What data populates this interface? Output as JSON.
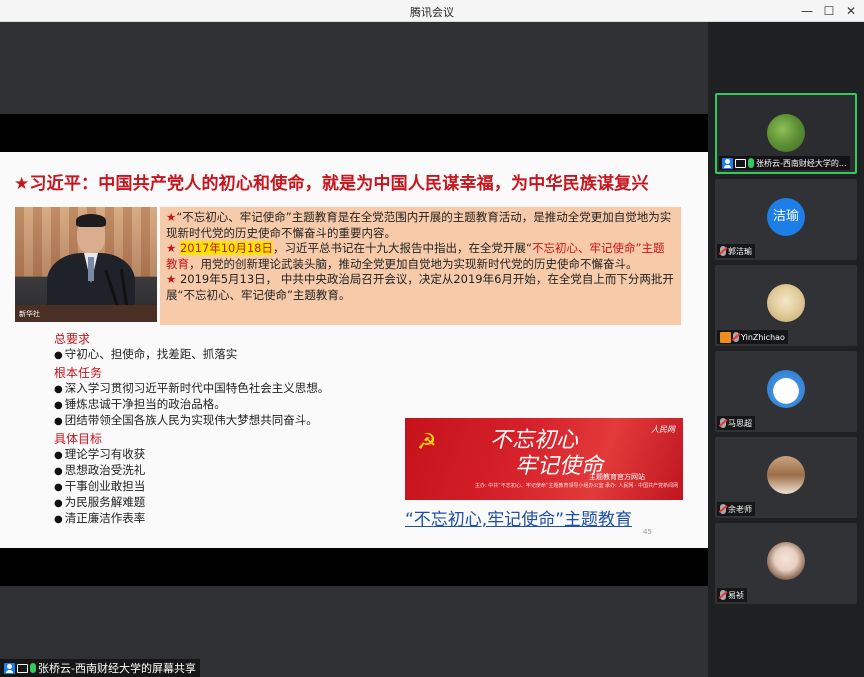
{
  "window": {
    "title": "腾讯会议",
    "controls": [
      "minimize-icon",
      "maximize-icon",
      "close-icon"
    ]
  },
  "slide": {
    "title": "★习近平：中国共产党人的初心和使命，就是为中国人民谋幸福，为中华民族谋复兴",
    "photo_credit": "新华社",
    "box": {
      "p1_star": "★",
      "p1_text": "“不忘初心、牢记使命”主题教育是在全党范围内开展的主题教育活动，是推动全党更加自觉地为实现新时代党的历史使命不懈奋斗的重要内容。",
      "p2_star": "★",
      "p2_date": "2017年10月18日",
      "p2_text_a": "，习近平总书记在十九大报告中指出，在全党开展“",
      "p2_red": "不忘初心、牢记使命”主题教育",
      "p2_text_b": "，用党的创新理论武装头脑，推动全党更加自觉地为实现新时代党的历史使命不懈奋斗。",
      "p3_star": "★",
      "p3_text": " 2019年5月13日， 中共中央政治局召开会议，决定从2019年6月开始，在全党自上而下分两批开展“不忘初心、牢记使命”主题教育。"
    },
    "sections": [
      {
        "heading": "总要求",
        "items": [
          "守初心、担使命，找差距、抓落实"
        ]
      },
      {
        "heading": "根本任务",
        "items": [
          "深入学习贯彻习近平新时代中国特色社会主义思想。",
          "锤炼忠诚干净担当的政治品格。",
          "团结带领全国各族人民为实现伟大梦想共同奋斗。"
        ]
      },
      {
        "heading": "具体目标",
        "items": [
          "理论学习有收获",
          "思想政治受洗礼",
          "干事创业敢担当",
          "为民服务解难题",
          "清正廉洁作表率"
        ]
      }
    ],
    "banner": {
      "calligraphy_line1": "不忘初心",
      "calligraphy_line2": "牢记使命",
      "subtitle": "主题教育官方网站",
      "fineprint": "主办: 中共“不忘初心、牢记使命”主题教育领导小组办公室  承办: 人民网 · 中国共产党新闻网",
      "logo": "人民网"
    },
    "link_text": "“不忘初心,牢记使命”主题教育",
    "page_number": "45"
  },
  "share_label": "张桥云-西南财经大学的屏幕共享",
  "participants": [
    {
      "name": "张桥云-西南财经大学的...",
      "avatar": "photo",
      "active": true,
      "mic": "on",
      "screen": true,
      "user_icon": true
    },
    {
      "name": "郭洁瑜",
      "avatar": "text",
      "avatar_text": "洁瑜",
      "active": false,
      "mic": "off"
    },
    {
      "name": "YinZhichao",
      "avatar": "photo",
      "active": false,
      "mic": "off",
      "host": true
    },
    {
      "name": "马思超",
      "avatar": "photo",
      "active": false,
      "mic": "off"
    },
    {
      "name": "余老师",
      "avatar": "photo",
      "active": false,
      "mic": "off"
    },
    {
      "name": "易祯",
      "avatar": "photo",
      "active": false,
      "mic": "off"
    }
  ],
  "colors": {
    "accent_red": "#c8141c",
    "highlight_yellow": "#ffe600",
    "box_bg": "#f7cbaa",
    "active_border": "#37c85b",
    "link_blue": "#1f4fa6"
  }
}
